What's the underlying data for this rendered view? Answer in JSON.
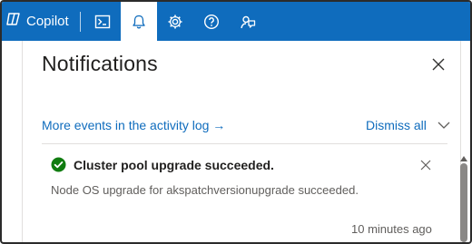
{
  "topbar": {
    "brand_label": "Copilot",
    "icons": [
      "copilot-icon",
      "terminal-icon",
      "bell-icon",
      "gear-icon",
      "help-icon",
      "feedback-icon"
    ],
    "accent_color": "#0f6cbd"
  },
  "panel": {
    "title": "Notifications",
    "activity_link": "More events in the activity log →",
    "dismiss_label": "Dismiss all"
  },
  "notification": {
    "title": "Cluster pool upgrade succeeded.",
    "body": "Node OS upgrade for akspatchversionupgrade succeeded.",
    "time": "10 minutes ago",
    "status_color": "#107c10"
  }
}
